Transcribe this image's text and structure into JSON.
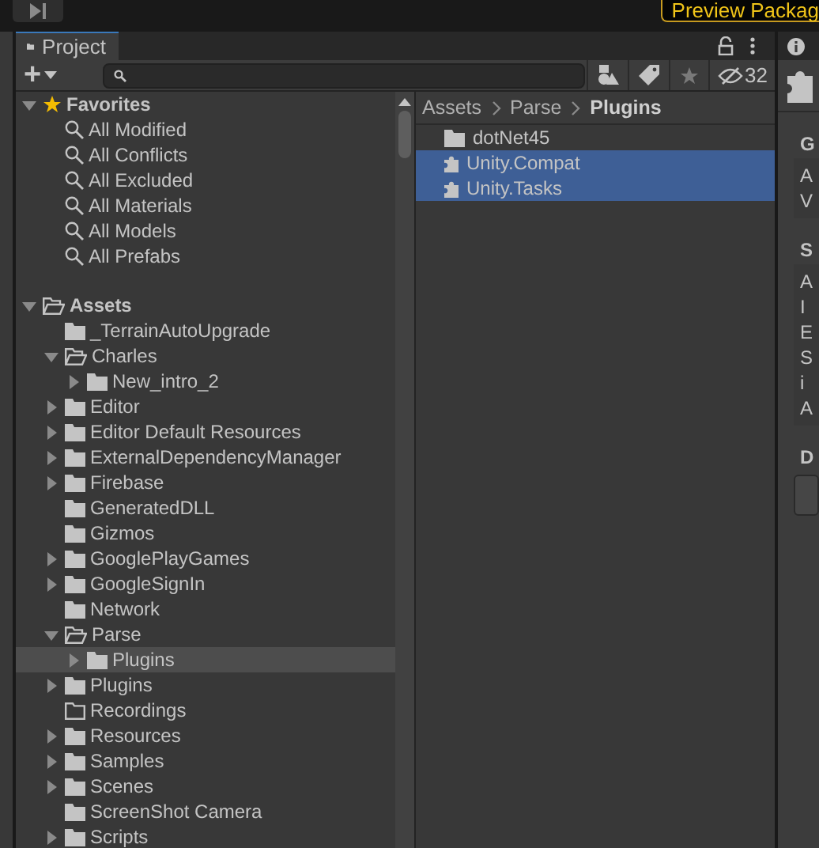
{
  "top_bar": {
    "preview_button": "Preview Packag"
  },
  "project_panel": {
    "tab": {
      "label": "Project",
      "selected": true
    },
    "toolbar": {
      "add": "+",
      "hidden_count": "32"
    },
    "favorites": {
      "label": "Favorites",
      "expanded": true,
      "items": [
        "All Modified",
        "All Conflicts",
        "All Excluded",
        "All Materials",
        "All Models",
        "All Prefabs"
      ]
    },
    "assets": {
      "label": "Assets",
      "expandable": true,
      "expanded": true,
      "empty": false,
      "selected": false,
      "children": [
        {
          "label": "_TerrainAutoUpgrade",
          "expandable": false,
          "expanded": false,
          "empty": false,
          "selected": false
        },
        {
          "label": "Charles",
          "expandable": true,
          "expanded": true,
          "empty": false,
          "selected": false,
          "children": [
            {
              "label": "New_intro_2",
              "expandable": true,
              "expanded": false,
              "empty": false,
              "selected": false
            }
          ]
        },
        {
          "label": "Editor",
          "expandable": true,
          "expanded": false,
          "empty": false,
          "selected": false
        },
        {
          "label": "Editor Default Resources",
          "expandable": true,
          "expanded": false,
          "empty": false,
          "selected": false
        },
        {
          "label": "ExternalDependencyManager",
          "expandable": true,
          "expanded": false,
          "empty": false,
          "selected": false
        },
        {
          "label": "Firebase",
          "expandable": true,
          "expanded": false,
          "empty": false,
          "selected": false
        },
        {
          "label": "GeneratedDLL",
          "expandable": false,
          "expanded": false,
          "empty": false,
          "selected": false
        },
        {
          "label": "Gizmos",
          "expandable": false,
          "expanded": false,
          "empty": false,
          "selected": false
        },
        {
          "label": "GooglePlayGames",
          "expandable": true,
          "expanded": false,
          "empty": false,
          "selected": false
        },
        {
          "label": "GoogleSignIn",
          "expandable": true,
          "expanded": false,
          "empty": false,
          "selected": false
        },
        {
          "label": "Network",
          "expandable": false,
          "expanded": false,
          "empty": false,
          "selected": false
        },
        {
          "label": "Parse",
          "expandable": true,
          "expanded": true,
          "empty": false,
          "selected": false,
          "children": [
            {
              "label": "Plugins",
              "expandable": true,
              "expanded": false,
              "empty": false,
              "selected": true
            }
          ]
        },
        {
          "label": "Plugins",
          "expandable": true,
          "expanded": false,
          "empty": false,
          "selected": false
        },
        {
          "label": "Recordings",
          "expandable": false,
          "expanded": false,
          "empty": true,
          "selected": false
        },
        {
          "label": "Resources",
          "expandable": true,
          "expanded": false,
          "empty": false,
          "selected": false
        },
        {
          "label": "Samples",
          "expandable": true,
          "expanded": false,
          "empty": false,
          "selected": false
        },
        {
          "label": "Scenes",
          "expandable": true,
          "expanded": false,
          "empty": false,
          "selected": false
        },
        {
          "label": "ScreenShot Camera",
          "expandable": false,
          "expanded": false,
          "empty": false,
          "selected": false
        },
        {
          "label": "Scripts",
          "expandable": true,
          "expanded": false,
          "empty": false,
          "selected": false
        }
      ]
    },
    "breadcrumb": [
      "Assets",
      "Parse",
      "Plugins"
    ],
    "files": [
      {
        "kind": "folder",
        "label": "dotNet45",
        "selected": false
      },
      {
        "kind": "plugin",
        "label": "Unity.Compat",
        "selected": true
      },
      {
        "kind": "plugin",
        "label": "Unity.Tasks",
        "selected": true
      }
    ]
  },
  "inspector": {
    "sections": [
      {
        "kind": "rows",
        "header": "G",
        "rows": [
          "A",
          "V"
        ]
      },
      {
        "kind": "rows",
        "header": "S",
        "rows": [
          "A",
          "I",
          "E",
          "S",
          "i",
          "A"
        ]
      },
      {
        "kind": "field",
        "header": "D"
      }
    ]
  }
}
